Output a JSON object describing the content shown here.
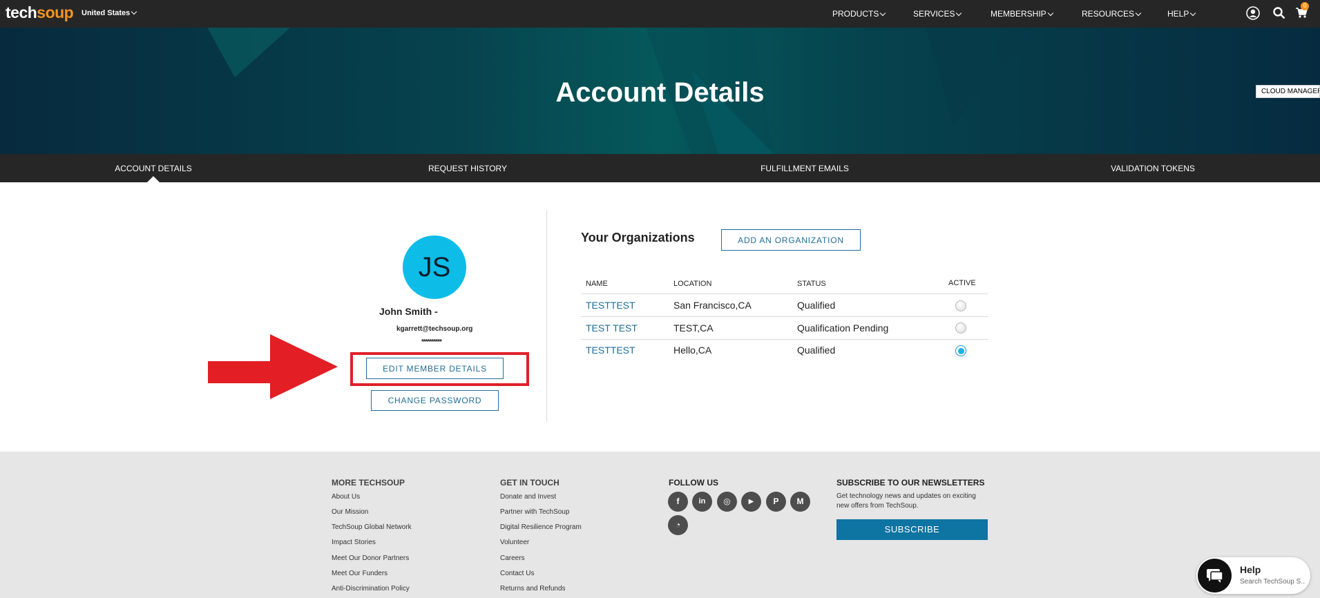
{
  "topnav": {
    "logo_part1": "tech",
    "logo_part2": "soup",
    "country": "United States",
    "menu": [
      "PRODUCTS",
      "SERVICES",
      "MEMBERSHIP",
      "RESOURCES",
      "HELP"
    ],
    "cart_count": "0",
    "icons": [
      "user-icon",
      "search-icon",
      "cart-icon"
    ]
  },
  "hero": {
    "title": "Account Details",
    "cloud_manager": "CLOUD MANAGER"
  },
  "subnav": {
    "items": [
      "ACCOUNT DETAILS",
      "REQUEST HISTORY",
      "FULFILLMENT EMAILS",
      "VALIDATION TOKENS"
    ],
    "active": "ACCOUNT DETAILS"
  },
  "profile": {
    "initials": "JS",
    "name": "John Smith -",
    "email": "kgarrett@techsoup.org",
    "password_mask": "**********",
    "edit_button": "EDIT MEMBER DETAILS",
    "change_password_button": "CHANGE PASSWORD",
    "avatar_color": "#0dbde8",
    "highlight_color": "#e0202a"
  },
  "organizations": {
    "title": "Your Organizations",
    "add_button": "ADD AN ORGANIZATION",
    "columns": [
      "NAME",
      "LOCATION",
      "STATUS",
      "ACTIVE"
    ],
    "rows": [
      {
        "name": "TESTTEST",
        "location": "San Francisco,CA",
        "status": "Qualified",
        "active": false
      },
      {
        "name": "TEST TEST",
        "location": "TEST,CA",
        "status": "Qualification Pending",
        "active": false
      },
      {
        "name": "TESTTEST",
        "location": "Hello,CA",
        "status": "Qualified",
        "active": true
      }
    ]
  },
  "footer": {
    "more": {
      "heading": "MORE TECHSOUP",
      "links": [
        "About Us",
        "Our Mission",
        "TechSoup Global Network",
        "Impact Stories",
        "Meet Our Donor Partners",
        "Meet Our Funders",
        "Anti-Discrimination Policy"
      ]
    },
    "contact": {
      "heading": "GET IN TOUCH",
      "links": [
        "Donate and Invest",
        "Partner with TechSoup",
        "Digital Resilience Program",
        "Volunteer",
        "Careers",
        "Contact Us",
        "Returns and Refunds"
      ]
    },
    "follow": {
      "heading": "FOLLOW US",
      "icons": [
        "facebook-icon",
        "linkedin-icon",
        "instagram-icon",
        "youtube-icon",
        "pinterest-icon",
        "medium-icon",
        "rss-icon"
      ],
      "glyphs": [
        "f",
        "in",
        "◎",
        "▶",
        "P",
        "M",
        "◔"
      ]
    },
    "newsletter": {
      "heading": "SUBSCRIBE TO OUR NEWSLETTERS",
      "description": "Get technology news and updates on exciting new offers from TechSoup.",
      "button": "SUBSCRIBE"
    }
  },
  "help_widget": {
    "title": "Help",
    "subtitle": "Search TechSoup S..."
  }
}
